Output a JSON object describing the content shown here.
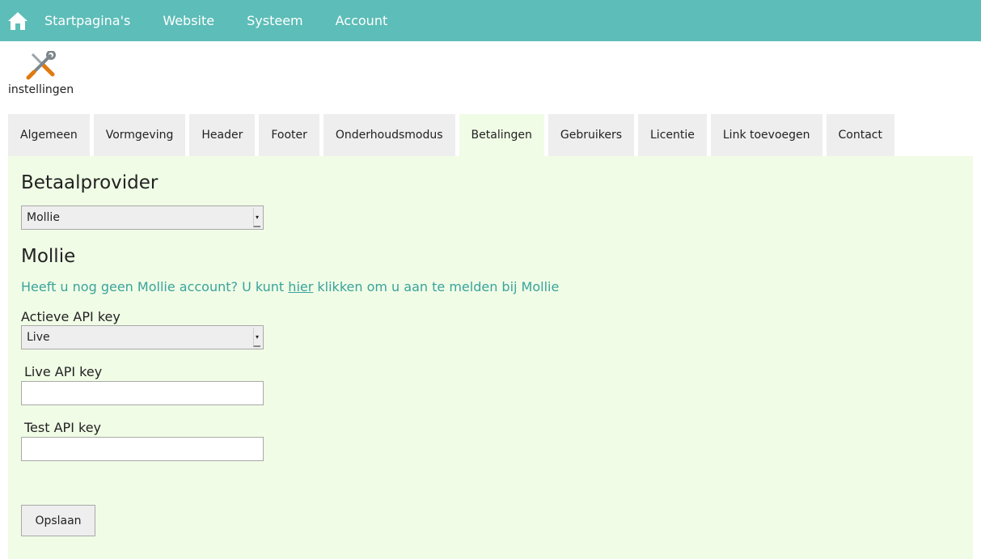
{
  "topnav": {
    "home_icon": "home-icon",
    "items": [
      "Startpagina's",
      "Website",
      "Systeem",
      "Account"
    ]
  },
  "page_header": {
    "icon": "tools-icon",
    "label": "instellingen"
  },
  "tabs": [
    {
      "label": "Algemeen"
    },
    {
      "label": "Vormgeving"
    },
    {
      "label": "Header"
    },
    {
      "label": "Footer"
    },
    {
      "label": "Onderhoudsmodus"
    },
    {
      "label": "Betalingen",
      "active": true
    },
    {
      "label": "Gebruikers"
    },
    {
      "label": "Licentie"
    },
    {
      "label": "Link toevoegen"
    },
    {
      "label": "Contact"
    }
  ],
  "panel": {
    "provider_title": "Betaalprovider",
    "provider_select_value": "Mollie",
    "mollie_title": "Mollie",
    "info_before": "Heeft u nog geen Mollie account? U kunt ",
    "info_link": "hier",
    "info_after": " klikken om u aan te melden bij Mollie",
    "active_key_label": "Actieve API key",
    "active_key_value": "Live",
    "live_key_label": "Live API key",
    "live_key_value": "",
    "test_key_label": "Test API key",
    "test_key_value": "",
    "save_label": "Opslaan"
  },
  "colors": {
    "topbar": "#5dbdb8",
    "panel_bg": "#f0fce6",
    "accent_text": "#3aa39c"
  }
}
